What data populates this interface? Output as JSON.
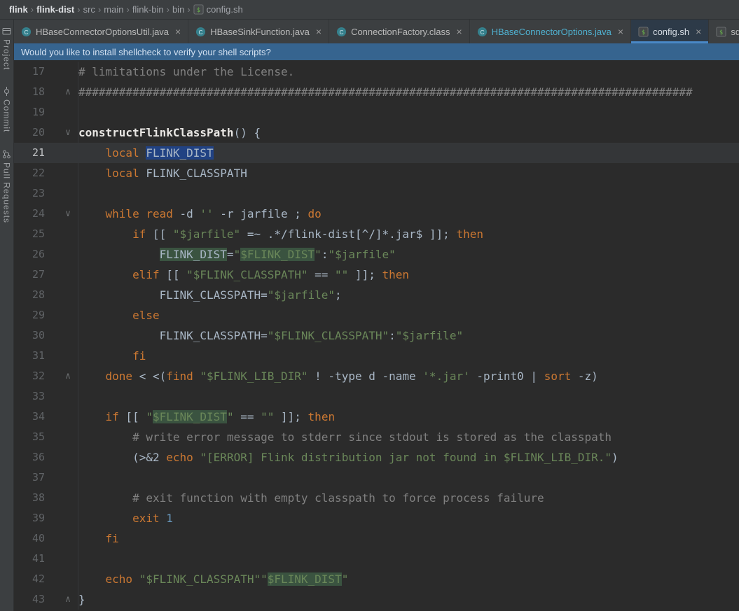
{
  "breadcrumb": {
    "items": [
      {
        "label": "flink",
        "bold": true
      },
      {
        "label": "flink-dist",
        "bold": true
      },
      {
        "label": "src"
      },
      {
        "label": "main"
      },
      {
        "label": "flink-bin"
      },
      {
        "label": "bin"
      },
      {
        "label": "config.sh",
        "icon": "shell"
      }
    ]
  },
  "tabs": [
    {
      "label": "HBaseConnectorOptionsUtil.java",
      "icon": "class",
      "close": true
    },
    {
      "label": "HBaseSinkFunction.java",
      "icon": "class",
      "close": true
    },
    {
      "label": "ConnectionFactory.class",
      "icon": "class",
      "close": true
    },
    {
      "label": "HBaseConnectorOptions.java",
      "icon": "class",
      "close": true,
      "modified": true
    },
    {
      "label": "config.sh",
      "icon": "shell",
      "close": true,
      "active": true
    },
    {
      "label": "sql-client.sh",
      "icon": "shell",
      "close": false
    }
  ],
  "banner": {
    "text": "Would you like to install shellcheck to verify your shell scripts?"
  },
  "tool_stripe": [
    {
      "label": "Project",
      "icon": "project"
    },
    {
      "label": "Commit",
      "icon": "commit"
    },
    {
      "label": "Pull Requests",
      "icon": "pull-requests"
    }
  ],
  "colors": {
    "accent_blue": "#4a88c7",
    "selection": "#214283",
    "usage_highlight": "#3a5340",
    "banner_bg": "#36648f",
    "keyword": "#cc7832",
    "string": "#6a8759",
    "comment": "#808080",
    "plain_text": "#a9b7c6",
    "modified_tab": "#4fb1d1"
  },
  "editor": {
    "current_line": 21,
    "lines": [
      {
        "n": 17,
        "seg": [
          [
            "cm",
            "# limitations under the License."
          ]
        ]
      },
      {
        "n": 18,
        "fold": "up",
        "seg": [
          [
            "cm",
            "###########################################################################################"
          ]
        ]
      },
      {
        "n": 19,
        "seg": []
      },
      {
        "n": 20,
        "fold": "down",
        "seg": [
          [
            "fn",
            "constructFlinkClassPath"
          ],
          [
            "pl",
            "() {"
          ]
        ]
      },
      {
        "n": 21,
        "seg": [
          [
            "pl",
            "    "
          ],
          [
            "kw",
            "local"
          ],
          [
            "pl",
            " "
          ],
          [
            "pl sel",
            "FLINK_DIST"
          ]
        ]
      },
      {
        "n": 22,
        "seg": [
          [
            "pl",
            "    "
          ],
          [
            "kw",
            "local"
          ],
          [
            "pl",
            " FLINK_CLASSPATH"
          ]
        ]
      },
      {
        "n": 23,
        "seg": []
      },
      {
        "n": 24,
        "fold": "down",
        "seg": [
          [
            "pl",
            "    "
          ],
          [
            "kw",
            "while"
          ],
          [
            "pl",
            " "
          ],
          [
            "kw",
            "read"
          ],
          [
            "pl",
            " -d "
          ],
          [
            "str",
            "''"
          ],
          [
            "pl",
            " -r jarfile ; "
          ],
          [
            "kw",
            "do"
          ]
        ]
      },
      {
        "n": 25,
        "seg": [
          [
            "pl",
            "        "
          ],
          [
            "kw",
            "if"
          ],
          [
            "pl",
            " [[ "
          ],
          [
            "str",
            "\"$jarfile\""
          ],
          [
            "pl",
            " =~ .*/flink-dist[^/]*.jar$ ]]; "
          ],
          [
            "kw",
            "then"
          ]
        ]
      },
      {
        "n": 26,
        "seg": [
          [
            "pl",
            "            "
          ],
          [
            "pl hl",
            "FLINK_DIST"
          ],
          [
            "pl",
            "="
          ],
          [
            "str",
            "\""
          ],
          [
            "str hl",
            "$FLINK_DIST"
          ],
          [
            "str",
            "\""
          ],
          [
            "pl",
            ":"
          ],
          [
            "str",
            "\"$jarfile\""
          ]
        ]
      },
      {
        "n": 27,
        "seg": [
          [
            "pl",
            "        "
          ],
          [
            "kw",
            "elif"
          ],
          [
            "pl",
            " [[ "
          ],
          [
            "str",
            "\"$FLINK_CLASSPATH\""
          ],
          [
            "pl",
            " == "
          ],
          [
            "str",
            "\"\""
          ],
          [
            "pl",
            " ]]; "
          ],
          [
            "kw",
            "then"
          ]
        ]
      },
      {
        "n": 28,
        "seg": [
          [
            "pl",
            "            FLINK_CLASSPATH="
          ],
          [
            "str",
            "\"$jarfile\""
          ],
          [
            "pl",
            ";"
          ]
        ]
      },
      {
        "n": 29,
        "seg": [
          [
            "pl",
            "        "
          ],
          [
            "kw",
            "else"
          ]
        ]
      },
      {
        "n": 30,
        "seg": [
          [
            "pl",
            "            FLINK_CLASSPATH="
          ],
          [
            "str",
            "\"$FLINK_CLASSPATH\""
          ],
          [
            "pl",
            ":"
          ],
          [
            "str",
            "\"$jarfile\""
          ]
        ]
      },
      {
        "n": 31,
        "seg": [
          [
            "pl",
            "        "
          ],
          [
            "kw",
            "fi"
          ]
        ]
      },
      {
        "n": 32,
        "fold": "up",
        "seg": [
          [
            "pl",
            "    "
          ],
          [
            "kw",
            "done"
          ],
          [
            "pl",
            " < <("
          ],
          [
            "kw",
            "find"
          ],
          [
            "pl",
            " "
          ],
          [
            "str",
            "\"$FLINK_LIB_DIR\""
          ],
          [
            "pl",
            " ! -type d -name "
          ],
          [
            "str",
            "'*.jar'"
          ],
          [
            "pl",
            " -print0 | "
          ],
          [
            "kw",
            "sort"
          ],
          [
            "pl",
            " -z)"
          ]
        ]
      },
      {
        "n": 33,
        "seg": []
      },
      {
        "n": 34,
        "seg": [
          [
            "pl",
            "    "
          ],
          [
            "kw",
            "if"
          ],
          [
            "pl",
            " [[ "
          ],
          [
            "str",
            "\""
          ],
          [
            "str hl",
            "$FLINK_DIST"
          ],
          [
            "str",
            "\""
          ],
          [
            "pl",
            " == "
          ],
          [
            "str",
            "\"\""
          ],
          [
            "pl",
            " ]]; "
          ],
          [
            "kw",
            "then"
          ]
        ]
      },
      {
        "n": 35,
        "seg": [
          [
            "pl",
            "        "
          ],
          [
            "cm",
            "# write error message to stderr since stdout is stored as the classpath"
          ]
        ]
      },
      {
        "n": 36,
        "seg": [
          [
            "pl",
            "        (>&2 "
          ],
          [
            "kw",
            "echo"
          ],
          [
            "pl",
            " "
          ],
          [
            "str",
            "\"[ERROR] Flink distribution jar not found in $FLINK_LIB_DIR.\""
          ],
          [
            "pl",
            ")"
          ]
        ]
      },
      {
        "n": 37,
        "seg": []
      },
      {
        "n": 38,
        "seg": [
          [
            "pl",
            "        "
          ],
          [
            "cm",
            "# exit function with empty classpath to force process failure"
          ]
        ]
      },
      {
        "n": 39,
        "seg": [
          [
            "pl",
            "        "
          ],
          [
            "kw",
            "exit"
          ],
          [
            "pl",
            " "
          ],
          [
            "num",
            "1"
          ]
        ]
      },
      {
        "n": 40,
        "seg": [
          [
            "pl",
            "    "
          ],
          [
            "kw",
            "fi"
          ]
        ]
      },
      {
        "n": 41,
        "seg": []
      },
      {
        "n": 42,
        "seg": [
          [
            "pl",
            "    "
          ],
          [
            "kw",
            "echo"
          ],
          [
            "pl",
            " "
          ],
          [
            "str",
            "\"$FLINK_CLASSPATH\"\""
          ],
          [
            "str hl",
            "$FLINK_DIST"
          ],
          [
            "str",
            "\""
          ]
        ]
      },
      {
        "n": 43,
        "fold": "up",
        "seg": [
          [
            "pl",
            "}"
          ]
        ]
      }
    ]
  }
}
